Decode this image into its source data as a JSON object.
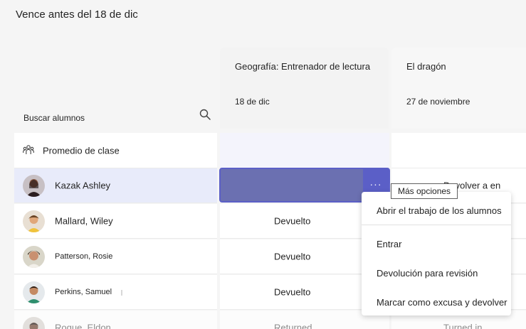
{
  "header": {
    "due_label": "Vence antes del 18 de dic"
  },
  "assignments": [
    {
      "title": "Geografía: Entrenador de lectura",
      "date": "18 de dic"
    },
    {
      "title": "El dragón",
      "date": "27 de noviembre"
    }
  ],
  "search": {
    "label": "Buscar alumnos"
  },
  "class_average": {
    "label": "Promedio de clase"
  },
  "students": [
    {
      "name": "Kazak Ashley",
      "col1": "",
      "col2": "Devolver a en"
    },
    {
      "name": "Mallard, Wiley",
      "col1": "Devuelto",
      "col2": ""
    },
    {
      "name": "Patterson, Rosie",
      "col1": "Devuelto",
      "col2": ""
    },
    {
      "name": "Perkins, Samuel",
      "col1": "Devuelto",
      "col2": ""
    },
    {
      "name": "Roque, Eldon",
      "col1": "Returned",
      "col2": "Turned in"
    }
  ],
  "cell_actions": {
    "more_glyph": "···"
  },
  "tooltip": {
    "text": "Más opciones"
  },
  "context_menu": {
    "items": [
      "Abrir el trabajo de los alumnos",
      "Entrar",
      "Devolución para revisión",
      "Marcar como excusa y devolver"
    ]
  },
  "colors": {
    "accent": "#5b5fc7",
    "selected_row": "#e8ebfa"
  },
  "icons": {
    "search": "search-icon",
    "class_average": "people-icon",
    "more": "more-options-icon"
  }
}
